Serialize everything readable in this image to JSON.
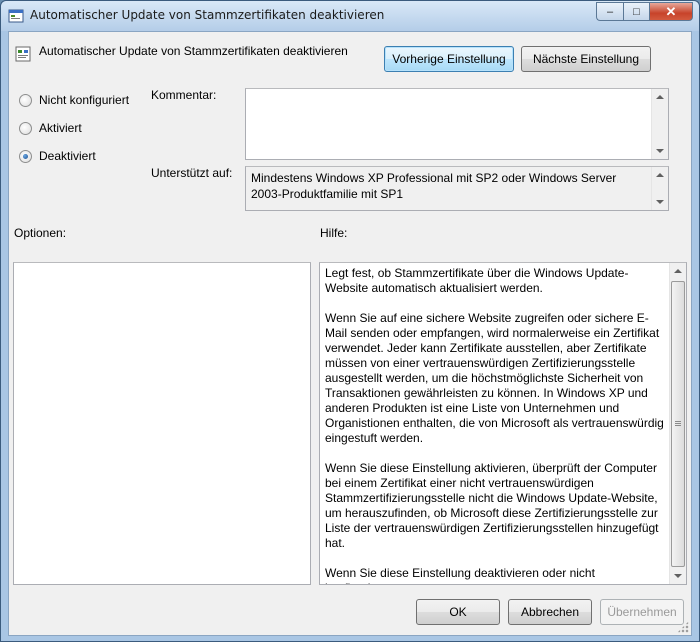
{
  "window": {
    "title": "Automatischer Update von Stammzertifikaten deaktivieren",
    "controls": {
      "minimize": "–",
      "maximize": "□",
      "close": "✕"
    }
  },
  "header": {
    "setting_title": "Automatischer Update von Stammzertifikaten deaktivieren",
    "prev_button": "Vorherige Einstellung",
    "next_button": "Nächste Einstellung"
  },
  "state_options": [
    {
      "label": "Nicht konfiguriert",
      "checked": false
    },
    {
      "label": "Aktiviert",
      "checked": false
    },
    {
      "label": "Deaktiviert",
      "checked": true
    }
  ],
  "comment": {
    "label": "Kommentar:",
    "value": ""
  },
  "supported": {
    "label": "Unterstützt auf:",
    "value": "Mindestens Windows XP Professional mit SP2 oder Windows Server 2003-Produktfamilie mit SP1"
  },
  "options": {
    "label": "Optionen:"
  },
  "help": {
    "label": "Hilfe:",
    "text": "Legt fest, ob Stammzertifikate über die Windows Update-Website automatisch aktualisiert werden.\n\nWenn Sie auf eine sichere Website zugreifen oder sichere E-Mail senden oder empfangen, wird normalerweise ein Zertifikat verwendet. Jeder kann Zertifikate ausstellen, aber Zertifikate müssen von einer vertrauenswürdigen Zertifizierungsstelle ausgestellt werden, um die höchstmöglichste Sicherheit von Transaktionen gewährleisten zu können. In Windows XP und anderen Produkten ist eine Liste von Unternehmen und Organistionen enthalten, die von Microsoft als vertrauenswürdig eingestuft werden.\n\nWenn Sie diese Einstellung aktivieren, überprüft der Computer bei einem Zertifikat einer nicht vertrauenswürdigen Stammzertifizierungsstelle nicht die Windows Update-Website, um herauszufinden, ob Microsoft diese Zertifizierungsstelle zur Liste der vertrauenswürdigen Zertifizierungsstellen hinzugefügt hat.\n\nWenn Sie diese Einstellung deaktivieren oder nicht konfigurieren,"
  },
  "footer": {
    "ok": "OK",
    "cancel": "Abbrechen",
    "apply": "Übernehmen"
  }
}
